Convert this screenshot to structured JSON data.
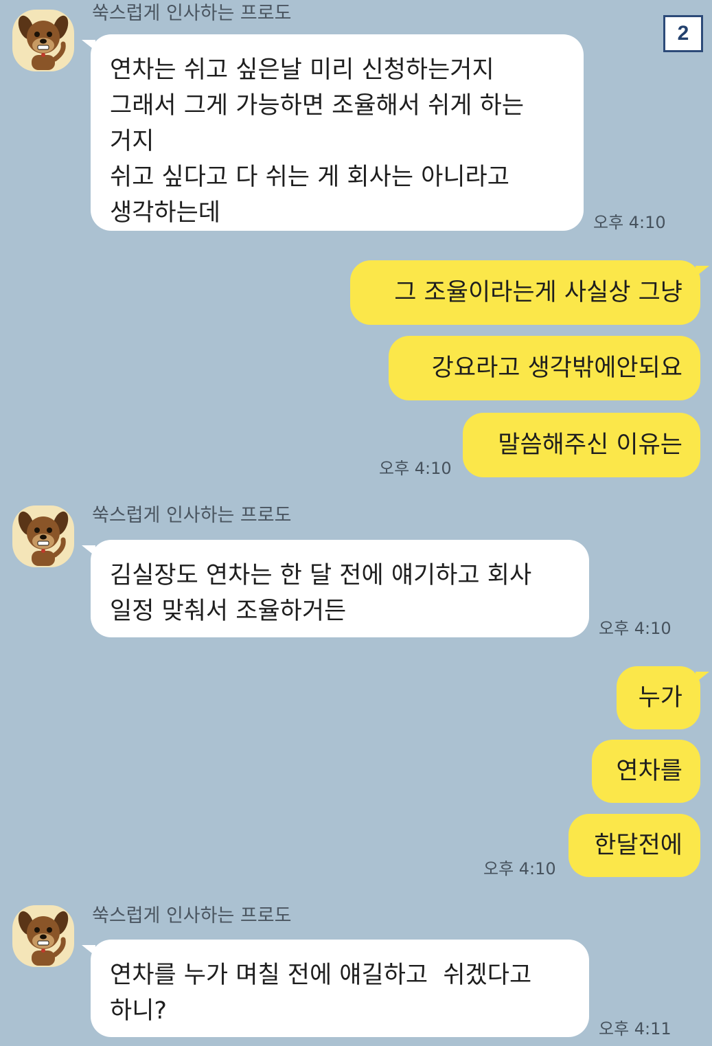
{
  "page_badge": "2",
  "colors": {
    "background": "#abc1d1",
    "incoming_bubble": "#ffffff",
    "outgoing_bubble": "#fbe74a",
    "badge_border": "#2c4a78"
  },
  "icons": {
    "avatar": "frodo-character-icon"
  },
  "messages": [
    {
      "sender": "쑥스럽게 인사하는 프로도",
      "direction": "incoming",
      "text": "연차는 쉬고 싶은날 미리 신청하는거지\n그래서 그게 가능하면 조율해서 쉬게 하는\n거지\n쉬고 싶다고 다 쉬는 게 회사는 아니라고\n생각하는데",
      "time": "오후 4:10"
    },
    {
      "direction": "outgoing",
      "texts": [
        "그 조율이라는게 사실상 그냥",
        "강요라고 생각밖에안되요",
        "말씀해주신 이유는"
      ],
      "time": "오후 4:10"
    },
    {
      "sender": "쑥스럽게 인사하는 프로도",
      "direction": "incoming",
      "text": "김실장도 연차는 한 달 전에 얘기하고 회사\n일정 맞춰서 조율하거든",
      "time": "오후 4:10"
    },
    {
      "direction": "outgoing",
      "texts": [
        "누가",
        "연차를",
        "한달전에"
      ],
      "time": "오후 4:10"
    },
    {
      "sender": "쑥스럽게 인사하는 프로도",
      "direction": "incoming",
      "text": "연차를 누가 며칠 전에 얘길하고  쉬겠다고\n하니?",
      "time": "오후 4:11"
    }
  ]
}
